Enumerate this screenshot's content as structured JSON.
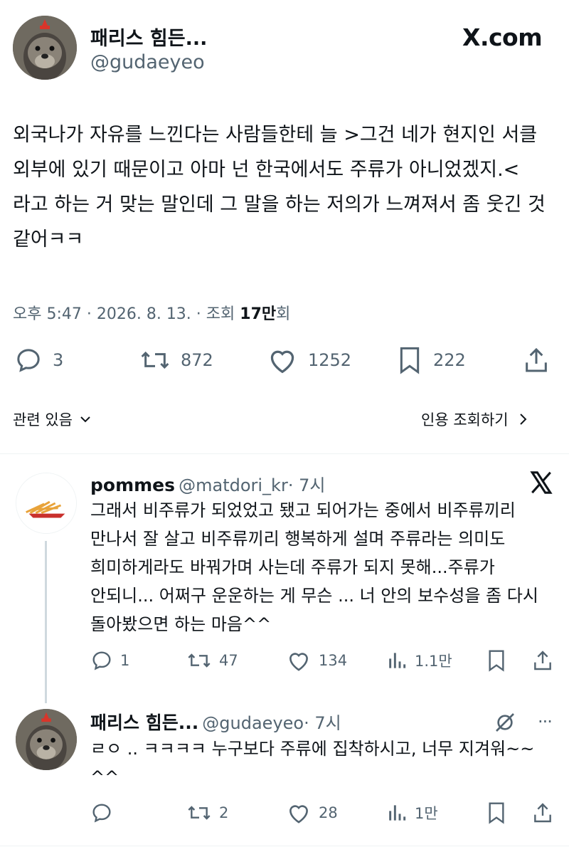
{
  "tweet": {
    "author_name": "패리스 힘든...",
    "author_handle": "@gudaeyeo",
    "site": "X.com",
    "text": "외국나가 자유를 느낀다는 사람들한테 늘 >그건 네가 현지인 서클 외부에 있기 때문이고 아마 넌 한국에서도 주류가 아니었겠지.< 라고 하는 거 맞는 말인데 그 말을 하는 저의가 느껴져서 좀 웃긴 것 같어ㅋㅋ",
    "time": "오후 5:47 · 2026. 8. 13. · 조회 ",
    "views": "17만",
    "views_suffix": "회",
    "replies": "3",
    "retweets": "872",
    "likes": "1252",
    "bookmarks": "222"
  },
  "related": {
    "related_label": "관련 있음",
    "quote_label": "인용 조회하기"
  },
  "replies": [
    {
      "name": "pommes",
      "handle": "@matdori_kr",
      "age": "· 7시",
      "text": "그래서 비주류가 되었었고 됐고 되어가는 중에서 비주류끼리 만나서 잘 살고 비주류끼리 행복하게 설며 주류라는 의미도 희미하게라도 바꿔가며 사는데 주류가 되지 못해...주류가 안되니... 어쩌구 운운하는 게 무슨 ... 너 안의 보수성을 좀 다시 돌아봤으면 하는 마음^^",
      "replies": "1",
      "retweets": "47",
      "likes": "134",
      "views": "1.1만"
    },
    {
      "name": "패리스 힘든...",
      "handle": "@gudaeyeo",
      "age": "· 7시",
      "text": "ㄹㅇ .. ㅋㅋㅋㅋ 누구보다 주류에 집착하시고, 너무 지겨워~~ ^^",
      "replies": "",
      "retweets": "2",
      "likes": "28",
      "views": "1만"
    }
  ],
  "colors": {
    "text": "#0f1419",
    "muted": "#536471",
    "divider": "#eff3f4"
  },
  "icons": [
    "otter-avatar-icon",
    "x-logo-icon",
    "reply-icon",
    "retweet-icon",
    "heart-icon",
    "bookmark-icon",
    "share-icon",
    "chevron-down-icon",
    "chevron-right-icon",
    "views-bar-icon",
    "more-icon",
    "grok-icon",
    "fries-avatar-icon"
  ]
}
